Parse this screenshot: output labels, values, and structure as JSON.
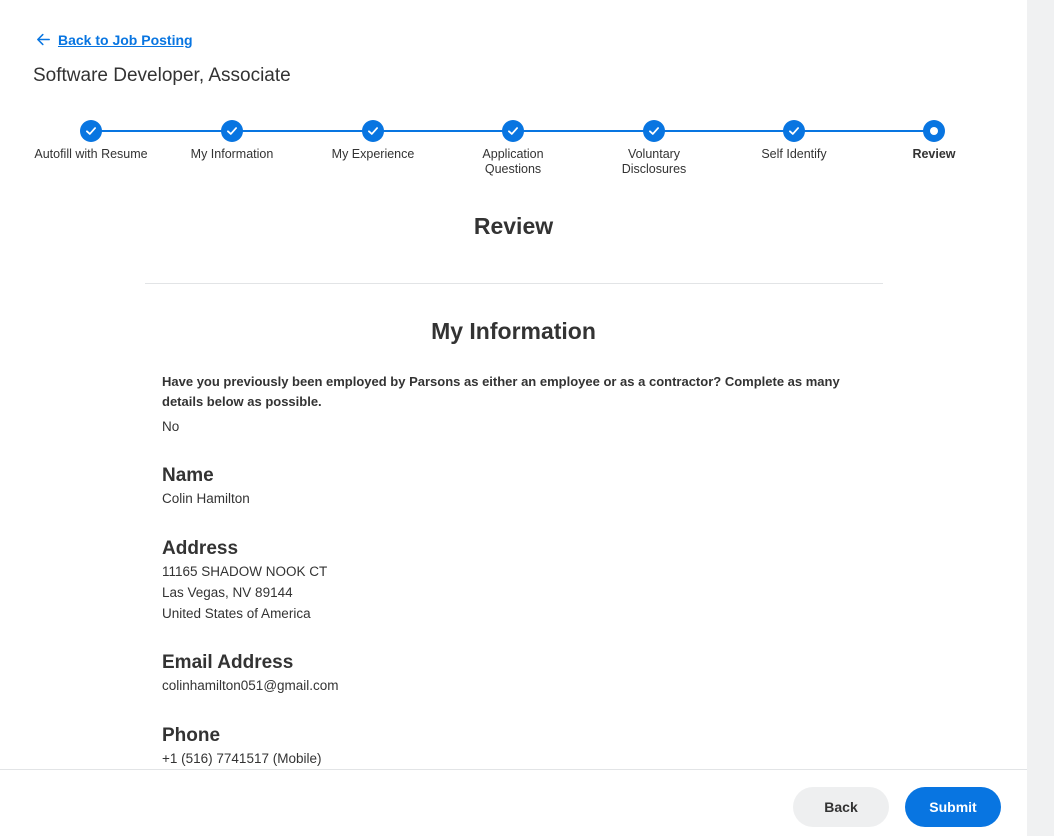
{
  "header": {
    "back_link": "Back to Job Posting",
    "job_title": "Software Developer, Associate"
  },
  "stepper": {
    "steps": [
      {
        "label": "Autofill with Resume",
        "status": "complete"
      },
      {
        "label": "My Information",
        "status": "complete"
      },
      {
        "label": "My Experience",
        "status": "complete"
      },
      {
        "label": "Application Questions",
        "status": "complete"
      },
      {
        "label": "Voluntary Disclosures",
        "status": "complete"
      },
      {
        "label": "Self Identify",
        "status": "complete"
      },
      {
        "label": "Review",
        "status": "current"
      }
    ]
  },
  "main": {
    "page_heading": "Review",
    "section_heading": "My Information",
    "previous_employment": {
      "question": "Have you previously been employed by Parsons as either an employee or as a contractor? Complete as many details below as possible.",
      "answer": "No"
    },
    "name": {
      "label": "Name",
      "value": "Colin Hamilton"
    },
    "address": {
      "label": "Address",
      "line1": "11165 SHADOW NOOK CT",
      "line2": "Las Vegas, NV 89144",
      "line3": "United States of America"
    },
    "email": {
      "label": "Email Address",
      "value": "colinhamilton051@gmail.com"
    },
    "phone": {
      "label": "Phone",
      "value": "+1 (516) 7741517 (Mobile)"
    }
  },
  "footer": {
    "back_label": "Back",
    "submit_label": "Submit"
  },
  "colors": {
    "accent": "#0875e1",
    "text": "#333333",
    "divider": "#e2e4e6",
    "secondary_button": "#eeeff0"
  }
}
